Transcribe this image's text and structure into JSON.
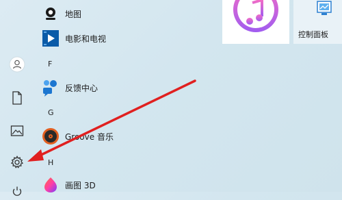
{
  "apps": {
    "maps_label": "地图",
    "movies_label": "电影和电视",
    "feedback_label": "反馈中心",
    "groove_label": "Groove 音乐",
    "paint3d_label": "画图 3D"
  },
  "letters": {
    "f": "F",
    "g": "G",
    "h": "H"
  },
  "tiles": {
    "control_panel_label": "控制面板"
  },
  "colors": {
    "arrow": "#e02020",
    "accent": "#0078d7"
  }
}
